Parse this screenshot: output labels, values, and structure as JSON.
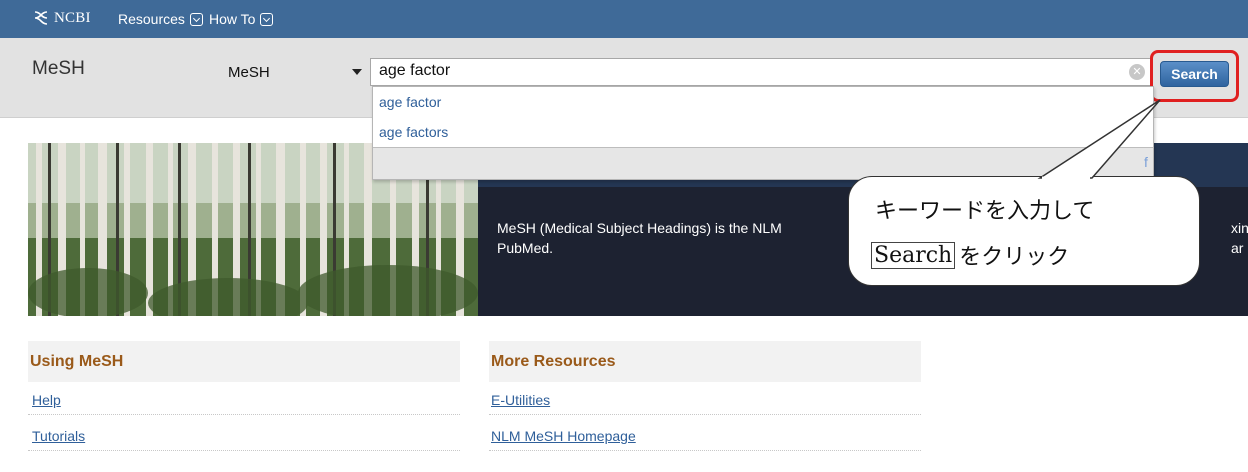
{
  "topbar": {
    "logo_text": "NCBI",
    "menus": [
      {
        "label": "Resources"
      },
      {
        "label": "How To"
      }
    ]
  },
  "search": {
    "db_title": "MeSH",
    "db_selected": "MeSH",
    "query": "age factor",
    "clear_glyph": "✕",
    "button_label": "Search"
  },
  "autocomplete": {
    "suggestions": [
      "age factor",
      "age factors"
    ],
    "footer_fragment": "f"
  },
  "banner": {
    "description": "MeSH (Medical Subject Headings) is the NLM",
    "description_cont": "PubMed.",
    "cut_text": "xing ar"
  },
  "callout": {
    "line1": "キーワードを入力して",
    "button_ref": "Search",
    "line2_suffix": "をクリック"
  },
  "sections": {
    "using": {
      "title": "Using MeSH",
      "links": [
        "Help",
        "Tutorials"
      ]
    },
    "more": {
      "title": "More Resources",
      "links": [
        "E-Utilities",
        "NLM MeSH Homepage"
      ]
    }
  },
  "colors": {
    "topbar": "#3f6a98",
    "highlight": "#e02020",
    "section_title": "#9a5a1a",
    "link": "#2f5f9a"
  }
}
